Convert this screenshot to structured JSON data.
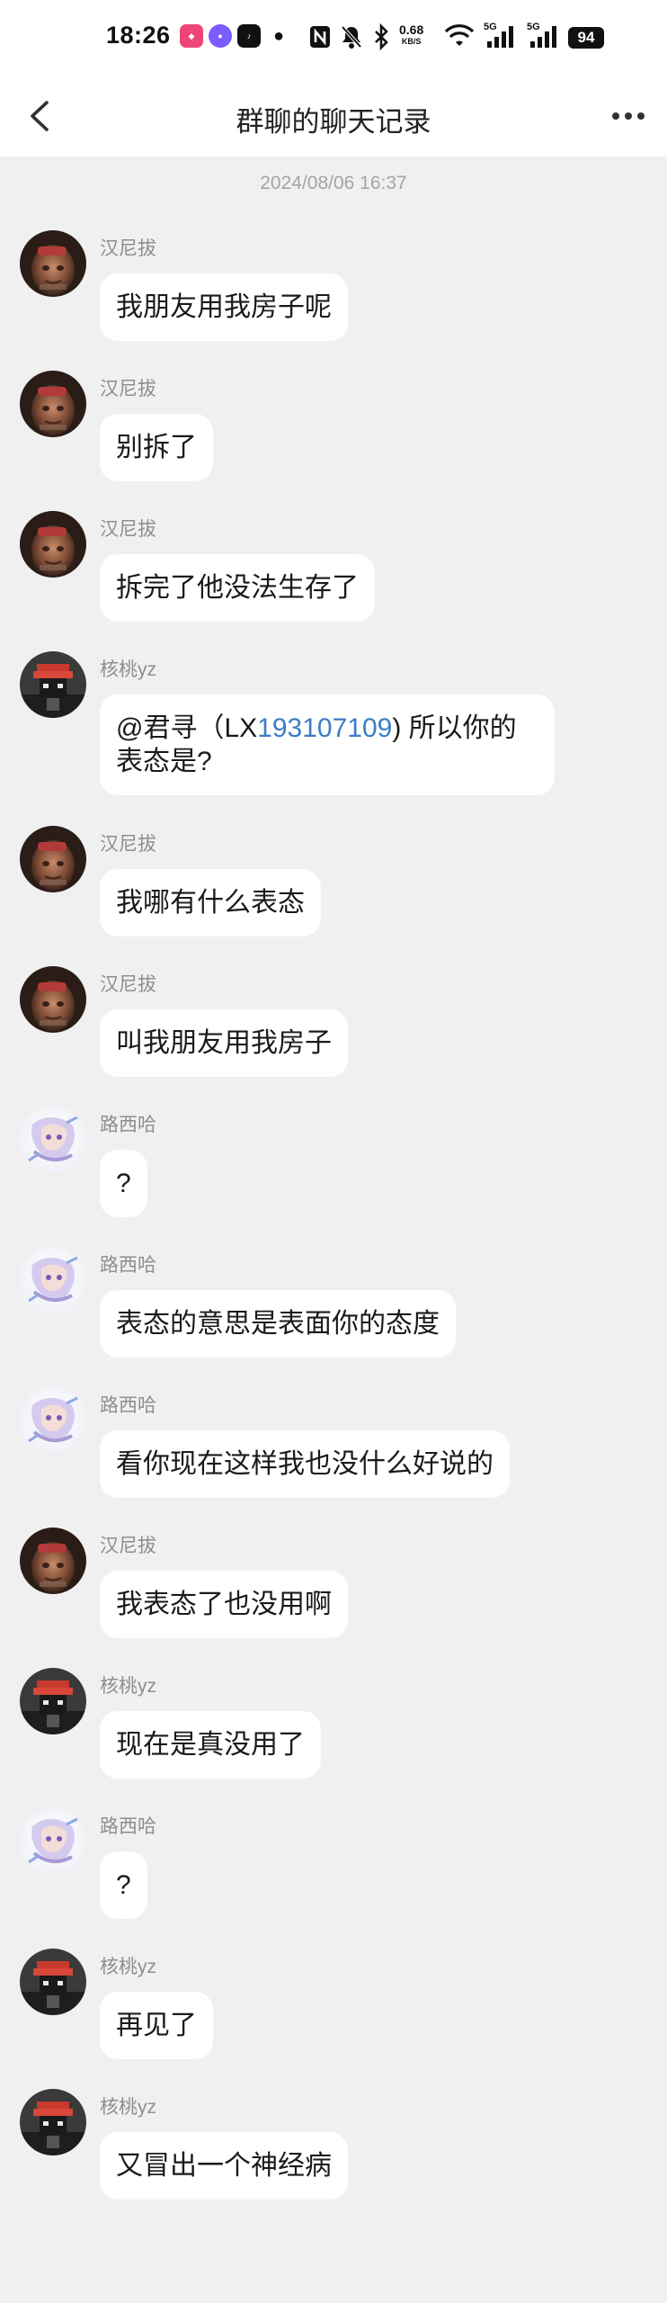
{
  "status_bar": {
    "time": "18:26",
    "net_speed": "0.68",
    "net_unit": "KB/S",
    "signal_1": "5G",
    "signal_2": "5G",
    "battery": "94"
  },
  "nav": {
    "title": "群聊的聊天记录"
  },
  "timestamp": "2024/08/06 16:37",
  "messages": [
    {
      "sender": "汉尼拔",
      "text": "我朋友用我房子呢",
      "avatar": "hannibal"
    },
    {
      "sender": "汉尼拔",
      "text": "别拆了",
      "avatar": "hannibal"
    },
    {
      "sender": "汉尼拔",
      "text": "拆完了他没法生存了",
      "avatar": "hannibal"
    },
    {
      "sender": "核桃yz",
      "text_parts": [
        "@君寻（LX",
        "193107109",
        ") 所以你的表态是?"
      ],
      "avatar": "hetao"
    },
    {
      "sender": "汉尼拔",
      "text": "我哪有什么表态",
      "avatar": "hannibal"
    },
    {
      "sender": "汉尼拔",
      "text": "叫我朋友用我房子",
      "avatar": "hannibal"
    },
    {
      "sender": "路西哈",
      "text": "?",
      "avatar": "luxiha"
    },
    {
      "sender": "路西哈",
      "text": "表态的意思是表面你的态度",
      "avatar": "luxiha"
    },
    {
      "sender": "路西哈",
      "text": "看你现在这样我也没什么好说的",
      "avatar": "luxiha"
    },
    {
      "sender": "汉尼拔",
      "text": "我表态了也没用啊",
      "avatar": "hannibal"
    },
    {
      "sender": "核桃yz",
      "text": "现在是真没用了",
      "avatar": "hetao"
    },
    {
      "sender": "路西哈",
      "text": "?",
      "avatar": "luxiha"
    },
    {
      "sender": "核桃yz",
      "text": "再见了",
      "avatar": "hetao"
    },
    {
      "sender": "核桃yz",
      "text": "又冒出一个神经病",
      "avatar": "hetao"
    }
  ]
}
